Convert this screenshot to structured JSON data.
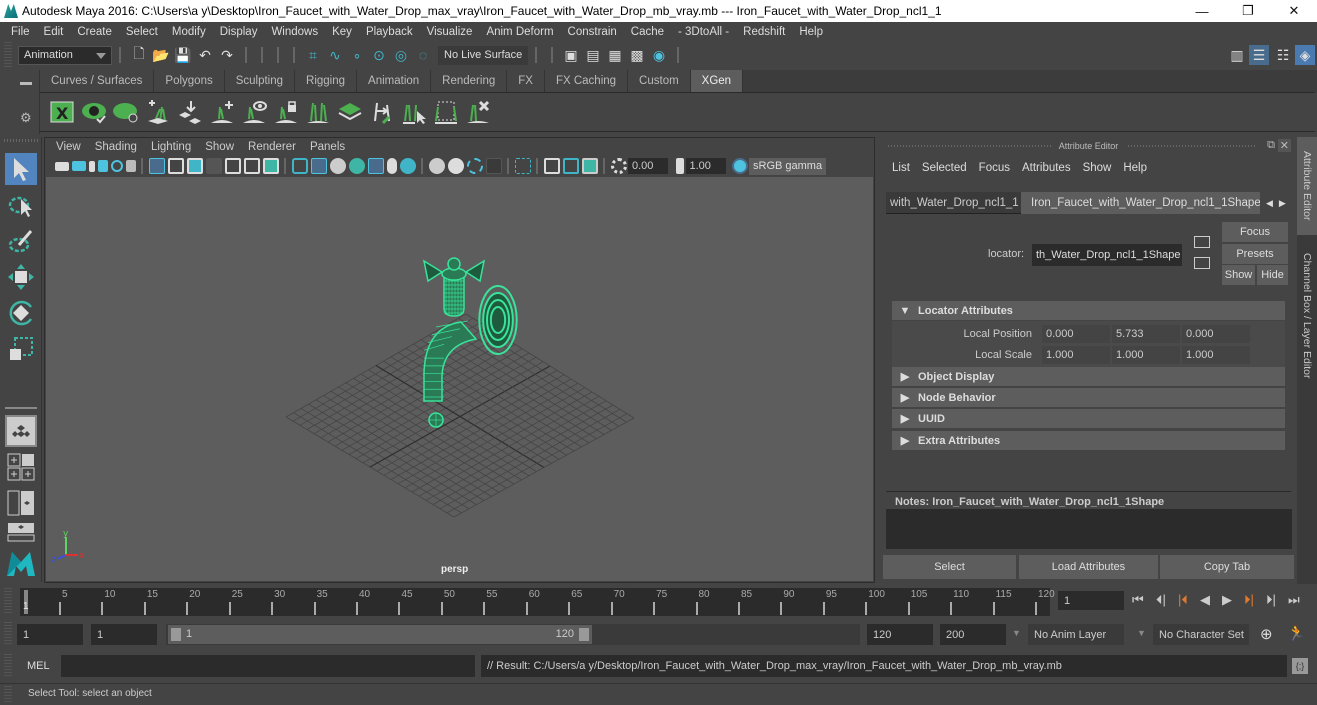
{
  "window": {
    "title": "Autodesk Maya 2016: C:\\Users\\a y\\Desktop\\Iron_Faucet_with_Water_Drop_max_vray\\Iron_Faucet_with_Water_Drop_mb_vray.mb  ---  Iron_Faucet_with_Water_Drop_ncl1_1",
    "minimize": "—",
    "maximize": "❐",
    "close": "✕"
  },
  "menubar": [
    "File",
    "Edit",
    "Create",
    "Select",
    "Modify",
    "Display",
    "Windows",
    "Key",
    "Playback",
    "Visualize",
    "Anim Deform",
    "Constrain",
    "Cache",
    "- 3DtoAll -",
    "Redshift",
    "Help"
  ],
  "statusline": {
    "mode": "Animation",
    "live_surface": "No Live Surface"
  },
  "shelf": {
    "tabs": [
      "Curves / Surfaces",
      "Polygons",
      "Sculpting",
      "Rigging",
      "Animation",
      "Rendering",
      "FX",
      "FX Caching",
      "Custom",
      "XGen"
    ],
    "active_tab": "XGen",
    "icons": [
      "xgen-editor-icon",
      "preview-visible-icon",
      "preview-hide-icon",
      "add-guides-icon",
      "place-guides-icon",
      "add-guide-icon",
      "show-guide-icon",
      "lock-guide-icon",
      "guides-icon",
      "density-icon",
      "sculpt-length-icon",
      "select-guides-icon",
      "guide-cv-icon",
      "delete-guides-icon"
    ]
  },
  "viewport": {
    "menu": [
      "View",
      "Shading",
      "Lighting",
      "Show",
      "Renderer",
      "Panels"
    ],
    "exposure": "0.00",
    "gamma": "1.00",
    "colorspace": "sRGB gamma",
    "camera": "persp",
    "axis": {
      "x": "x",
      "y": "y",
      "z": "z"
    },
    "wire_color": "#39e39a"
  },
  "attribute_editor": {
    "title": "Attribute Editor",
    "menu": [
      "List",
      "Selected",
      "Focus",
      "Attributes",
      "Show",
      "Help"
    ],
    "tabs": [
      "with_Water_Drop_ncl1_1",
      "Iron_Faucet_with_Water_Drop_ncl1_1Shape"
    ],
    "node_type_label": "locator:",
    "node_name": "th_Water_Drop_ncl1_1Shape",
    "buttons": {
      "focus": "Focus",
      "presets": "Presets",
      "show": "Show",
      "hide": "Hide"
    },
    "sections": [
      {
        "label": "Locator Attributes",
        "expanded": true
      },
      {
        "label": "Object Display",
        "expanded": false
      },
      {
        "label": "Node Behavior",
        "expanded": false
      },
      {
        "label": "UUID",
        "expanded": false
      },
      {
        "label": "Extra Attributes",
        "expanded": false
      }
    ],
    "attributes": [
      {
        "label": "Local Position",
        "values": [
          "0.000",
          "5.733",
          "0.000"
        ]
      },
      {
        "label": "Local Scale",
        "values": [
          "1.000",
          "1.000",
          "1.000"
        ]
      }
    ],
    "notes_label": "Notes:  Iron_Faucet_with_Water_Drop_ncl1_1Shape",
    "bottom_buttons": [
      "Select",
      "Load Attributes",
      "Copy Tab"
    ]
  },
  "side_tabs": [
    "Attribute Editor",
    "Channel Box / Layer Editor"
  ],
  "timeline": {
    "ticks": [
      5,
      10,
      15,
      20,
      25,
      30,
      35,
      40,
      45,
      50,
      55,
      60,
      65,
      70,
      75,
      80,
      85,
      90,
      95,
      100,
      105,
      110,
      115,
      120
    ],
    "start": 1,
    "end": 120,
    "current": "1",
    "current_frame_field": "1"
  },
  "range": {
    "start_field": "1",
    "playback_start": "1",
    "slider_start": "1",
    "slider_end": "120",
    "playback_end": "120",
    "end_field": "200",
    "anim_layer": "No Anim Layer",
    "character_set": "No Character Set"
  },
  "command_line": {
    "label": "MEL",
    "input": "",
    "result": "// Result: C:/Users/a y/Desktop/Iron_Faucet_with_Water_Drop_max_vray/Iron_Faucet_with_Water_Drop_mb_vray.mb"
  },
  "help_line": "Select Tool: select an object"
}
